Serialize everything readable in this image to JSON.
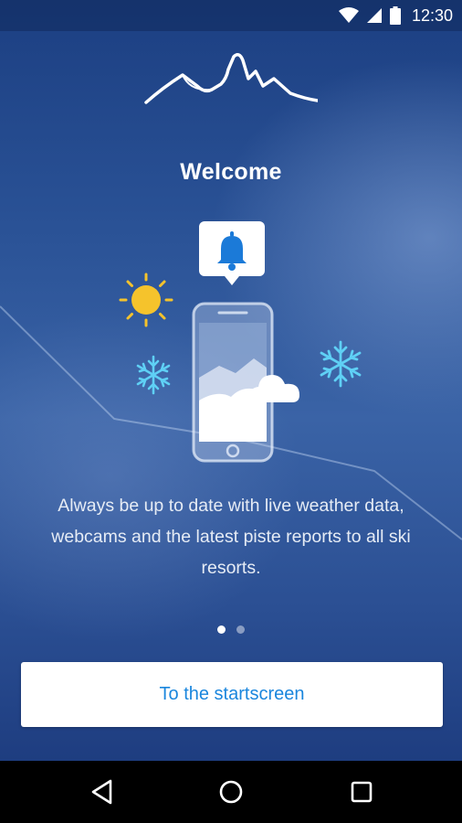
{
  "status_bar": {
    "time": "12:30",
    "icons": [
      "wifi-icon",
      "cellular-signal-icon",
      "battery-icon"
    ]
  },
  "onboarding": {
    "title": "Welcome",
    "description": "Always be up to date with live weather data, webcams and the latest piste reports to all ski resorts.",
    "page_indicator": {
      "current": 1,
      "total": 2
    },
    "primary_button": "To the startscreen",
    "illustration_icons": [
      "bell-notification-icon",
      "sun-icon",
      "snowflake-icon",
      "smartphone-icon",
      "mountain-icon",
      "cloud-icon"
    ]
  },
  "nav_bar": {
    "buttons": [
      "back-button",
      "home-button",
      "recents-button"
    ]
  },
  "colors": {
    "accent": "#1a86dd",
    "sun": "#f5c32c",
    "snowflake": "#5fd0f5",
    "background_top": "#1c3f82",
    "background_mid": "#3a63a6"
  }
}
